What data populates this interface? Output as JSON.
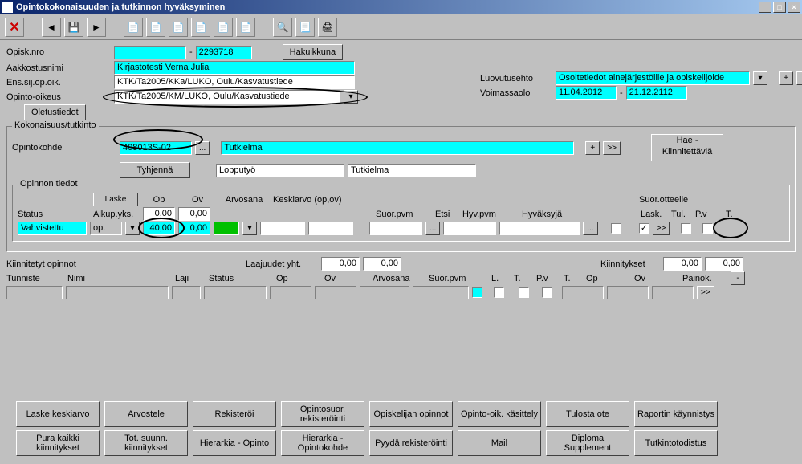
{
  "window": {
    "title": "Opintokokonaisuuden ja tutkinnon hyväksyminen"
  },
  "labels": {
    "opisk_nro": "Opisk.nro",
    "aakkostus": "Aakkostusnimi",
    "ens_sij": "Ens.sij.op.oik.",
    "opinto_oik": "Opinto-oikeus",
    "oletus": "Oletustiedot",
    "hakuikkuna": "Hakuikkuna",
    "luovutus": "Luovutusehto",
    "voimassa": "Voimassaolo",
    "kokonaisuus": "Kokonaisuus/tutkinto",
    "opintokohde": "Opintokohde",
    "tyhjenna": "Tyhjennä",
    "hae_kiinn": "Hae - Kiinnitettäviä",
    "opinnon": "Opinnon tiedot",
    "laske": "Laske",
    "op": "Op",
    "ov": "Ov",
    "arvosana": "Arvosana",
    "keskiarvo": "Keskiarvo (op,ov)",
    "status": "Status",
    "alkup": "Alkup.yks.",
    "suor_pvm": "Suor.pvm",
    "etsi": "Etsi",
    "hyv_pvm": "Hyv.pvm",
    "hyvaksyja": "Hyväksyjä",
    "suor_ott": "Suor.otteelle",
    "lask": "Lask.",
    "tul": "Tul.",
    "pv": "P.v",
    "t": "T.",
    "kiinn_op": "Kiinnitetyt opinnot",
    "laaj": "Laajuudet yht.",
    "kiinnit": "Kiinnitykset",
    "tunniste": "Tunniste",
    "nimi": "Nimi",
    "laji": "Laji",
    "l": "L.",
    "painok": "Painok.",
    "dash": "-",
    "plus": "+",
    "gt": ">>",
    "dotdot": "...",
    "minus": "-"
  },
  "values": {
    "opisk_no_blank": "",
    "opisk_no": "2293718",
    "nimi": "Kirjastotesti Verna Julia",
    "ens_sij": "KTK/Ta2005/KKa/LUKO, Oulu/Kasvatustiede",
    "opinto_oik": "KTK/Ta2005/KM/LUKO, Oulu/Kasvatustiede",
    "luovutus": "Osoitetiedot ainejärjestöille ja opiskelijoide",
    "voim1": "11.04.2012",
    "voim2": "21.12.2112",
    "opkode": "408013S-02",
    "ok_desc1": "Tutkielma",
    "ok_desc2a": "Lopputyö",
    "ok_desc2b": "Tutkielma",
    "op1": "0,00",
    "ov1": "0,00",
    "status_val": "Vahvistettu",
    "alkup_val": "op.",
    "op2": "40,00",
    "ov2": "0,00",
    "laaj1": "0,00",
    "laaj2": "0,00",
    "kiin1": "0,00",
    "kiin2": "0,00"
  },
  "bottom": {
    "r1": [
      "Laske keskiarvo",
      "Arvostele",
      "Rekisteröi",
      "Opintosuor. rekisteröinti",
      "Opiskelijan opinnot",
      "Opinto-oik. käsittely",
      "Tulosta ote",
      "Raportin käynnistys"
    ],
    "r2": [
      "Pura kaikki kiinnitykset",
      "Tot. suunn. kiinnitykset",
      "Hierarkia - Opinto",
      "Hierarkia - Opintokohde",
      "Pyydä rekisteröinti",
      "Mail",
      "Diploma Supplement",
      "Tutkintotodistus"
    ]
  }
}
